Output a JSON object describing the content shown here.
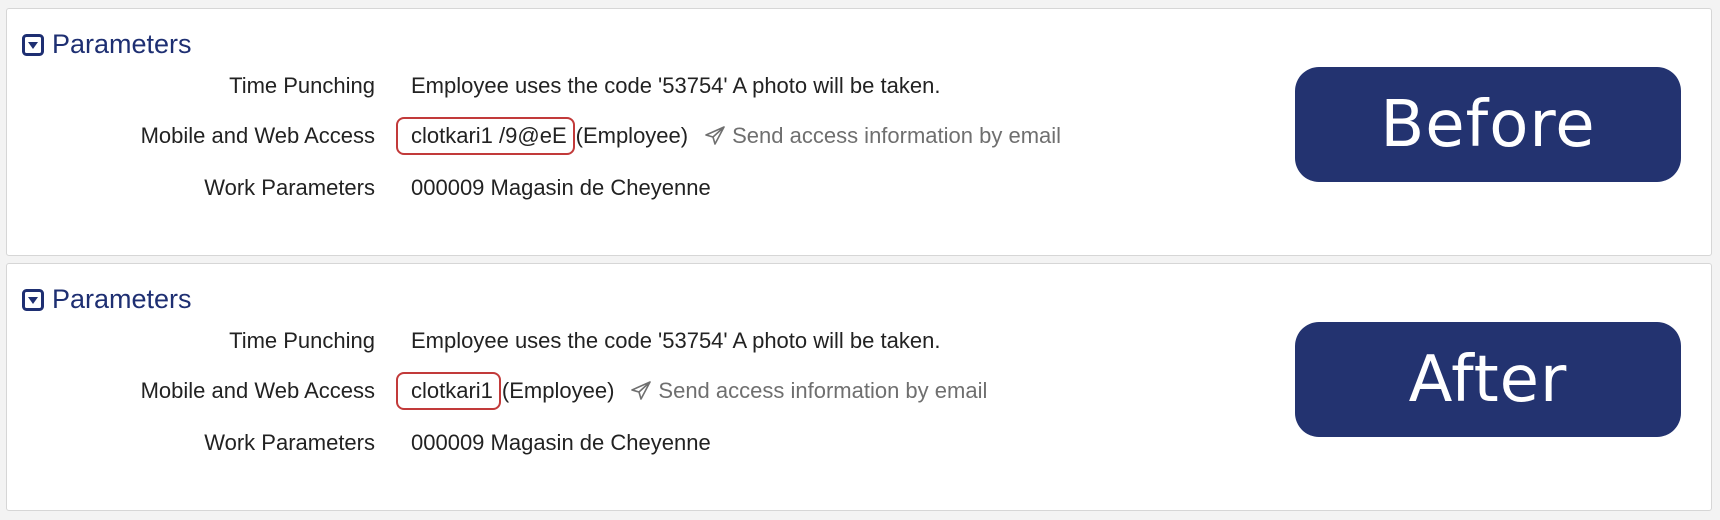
{
  "panels": [
    {
      "title": "Parameters",
      "badge": "Before",
      "rows": {
        "time_punching": {
          "label": "Time Punching",
          "value": "Employee uses the code '53754' A photo will be taken."
        },
        "mobile_access": {
          "label": "Mobile and Web Access",
          "username": "clotkari1 /9@eE",
          "role": "(Employee)",
          "send_link": "Send access information by email"
        },
        "work_parameters": {
          "label": "Work Parameters",
          "value": "000009 Magasin de Cheyenne"
        }
      }
    },
    {
      "title": "Parameters",
      "badge": "After",
      "rows": {
        "time_punching": {
          "label": "Time Punching",
          "value": "Employee uses the code '53754' A photo will be taken."
        },
        "mobile_access": {
          "label": "Mobile and Web Access",
          "username": "clotkari1",
          "role": "(Employee)",
          "send_link": "Send access information by email"
        },
        "work_parameters": {
          "label": "Work Parameters",
          "value": "000009 Magasin de Cheyenne"
        }
      }
    }
  ],
  "icons": {
    "collapse": "caret-down-square-icon",
    "send": "paper-plane-icon"
  },
  "colors": {
    "accent": "#1e2f72",
    "badge_bg": "#233370",
    "highlight_border": "#c23a3a"
  }
}
